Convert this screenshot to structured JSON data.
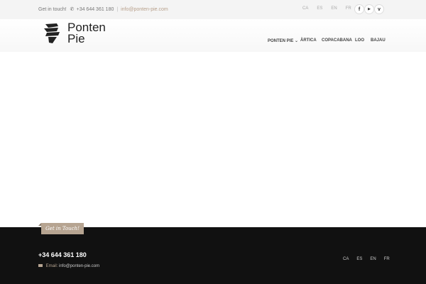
{
  "topbar": {
    "get_in_touch": "Get in touch!",
    "phone": "+34 644 361 180",
    "separator": "|",
    "email": "info@ponten-pie.com",
    "languages": [
      "CA",
      "ES",
      "EN",
      "FR"
    ],
    "social": [
      {
        "name": "facebook-icon",
        "glyph": "f"
      },
      {
        "name": "youtube-icon",
        "glyph": "▶"
      },
      {
        "name": "vimeo-icon",
        "glyph": "v"
      }
    ]
  },
  "brand": {
    "line1": "Ponten",
    "line2": "Pie"
  },
  "nav": {
    "items": [
      "PONTEN PIE",
      "ÀRTICA",
      "COPACABANA",
      "LOO",
      "BAJAU"
    ],
    "dropdown_glyph": "⌄"
  },
  "footer": {
    "tag": "Get in Touch!",
    "phone": "+34 644 361 180",
    "email_label": "Email:",
    "email": "info@ponten-pie.com",
    "languages": [
      "CA",
      "ES",
      "EN",
      "FR"
    ]
  },
  "colors": {
    "accent": "#b6a491",
    "footer_bg": "#111111",
    "topbar_bg": "#f4f4f4"
  }
}
